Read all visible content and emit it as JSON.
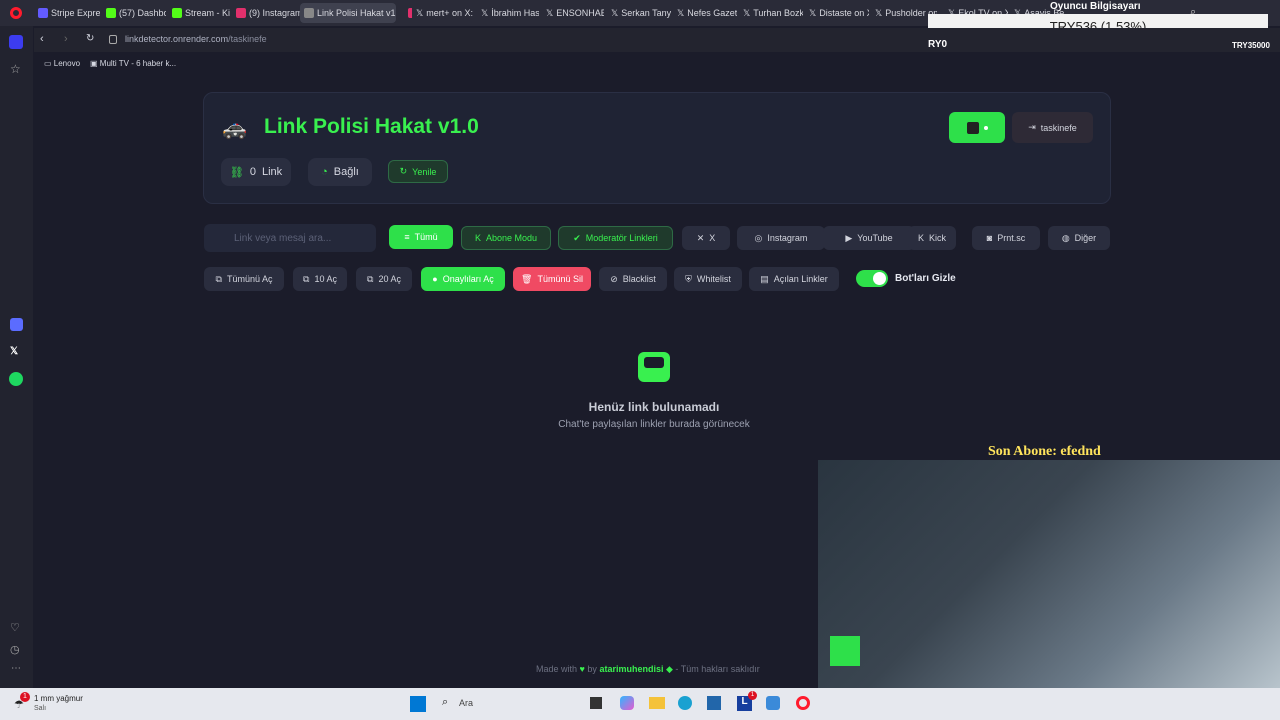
{
  "browser": {
    "tabs": [
      {
        "label": "Stripe Expres",
        "icon": "stripe-icon",
        "color": "#635bff"
      },
      {
        "label": "(57) Dashboa",
        "icon": "kick-icon",
        "color": "#53fc18"
      },
      {
        "label": "Stream - Kick",
        "icon": "kick-icon",
        "color": "#53fc18"
      },
      {
        "label": "(9) Instagram",
        "icon": "instagram-icon",
        "color": "#e1306c"
      },
      {
        "label": "Link Polisi Hakat v1.0",
        "icon": "police-icon",
        "color": "#888888",
        "active": true
      },
      {
        "label": "",
        "icon": "tab-marker",
        "color": "#e1306c"
      },
      {
        "label": "mert+ on X:",
        "icon": "x-icon",
        "color": "#000000"
      },
      {
        "label": "İbrahim Hask",
        "icon": "x-icon",
        "color": "#000000"
      },
      {
        "label": "ENSONHABE",
        "icon": "x-icon",
        "color": "#000000"
      },
      {
        "label": "Serkan Tanyi",
        "icon": "x-icon",
        "color": "#000000"
      },
      {
        "label": "Nefes Gazete",
        "icon": "x-icon",
        "color": "#000000"
      },
      {
        "label": "Turhan Bozk",
        "icon": "x-icon",
        "color": "#000000"
      },
      {
        "label": "Distaste on X",
        "icon": "x-icon",
        "color": "#000000"
      },
      {
        "label": "Pusholder on",
        "icon": "x-icon",
        "color": "#000000"
      },
      {
        "label": "Ekol TV on X",
        "icon": "x-icon",
        "color": "#000000"
      },
      {
        "label": "Asayiş Be",
        "icon": "x-icon",
        "color": "#000000"
      }
    ],
    "url_host": "linkdetector.onrender.com",
    "url_path": "/taskinefe",
    "bookmarks": [
      "Lenovo",
      "Multi TV - 6 haber k..."
    ]
  },
  "overlay": {
    "pc_label": "Oyuncu Bilgisayarı",
    "ticker": "TRY536 (1.53%)",
    "ticker_left": "RY0",
    "ticker_right": "TRY35000",
    "last_sub": "Son Abone: efednd"
  },
  "app": {
    "title": "Link Polisi Hakat v1.0",
    "link_count": "0",
    "link_label": "Link",
    "status": "Bağlı",
    "refresh": "Yenile",
    "user": "taskinefe",
    "search_placeholder": "Link veya mesaj ara...",
    "filters": [
      "Tümü",
      "Abone Modu",
      "Moderatör Linkleri",
      "X",
      "Instagram",
      "YouTube",
      "Kick",
      "Prnt.sc",
      "Diğer"
    ],
    "actions": [
      "Tümünü Aç",
      "10 Aç",
      "20 Aç",
      "Onaylıları Aç",
      "Tümünü Sil",
      "Blacklist",
      "Whitelist",
      "Açılan Linkler"
    ],
    "toggle_label": "Bot'ları Gizle",
    "toggle_on": true,
    "empty_title": "Henüz link bulunamadı",
    "empty_sub": "Chat'te paylaşılan linkler burada görünecek",
    "footer_made": "Made with",
    "footer_by": "by",
    "footer_author": "atarimuhendisi",
    "footer_rights": "- Tüm hakları saklıdır"
  },
  "taskbar": {
    "weather": "1 mm yağmur",
    "weather_sub": "Salı",
    "badge": "1",
    "search": "Ara",
    "notif": "1"
  },
  "colors": {
    "accent": "#39f04f",
    "danger": "#f04a63",
    "bg": "#1b1c2a"
  }
}
